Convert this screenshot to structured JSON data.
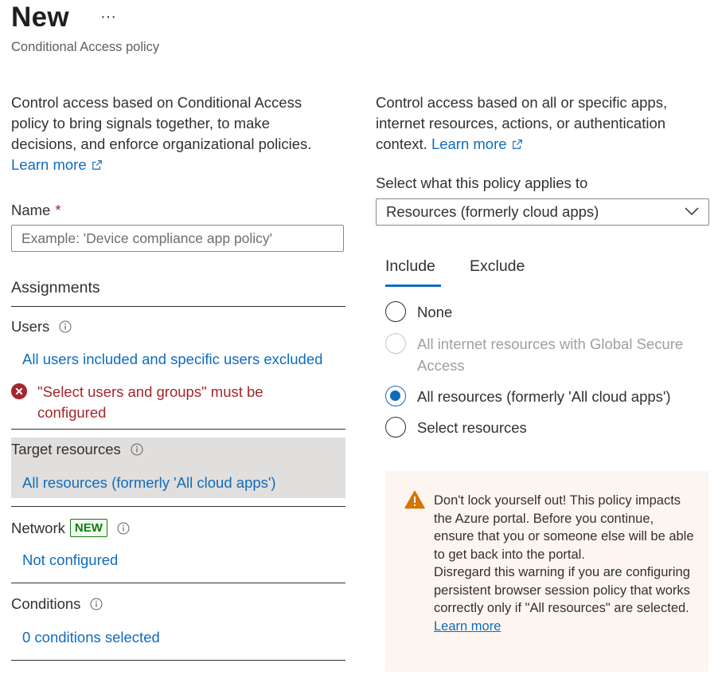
{
  "header": {
    "title": "New",
    "more_label": "···",
    "subtitle": "Conditional Access policy"
  },
  "left": {
    "description": "Control access based on Conditional Access policy to bring signals together, to make decisions, and enforce organizational policies.",
    "learn_more": "Learn more",
    "name_label": "Name",
    "name_required": "*",
    "name_placeholder": "Example: 'Device compliance app policy'",
    "name_value": "",
    "assignments_label": "Assignments",
    "users": {
      "label": "Users",
      "link": "All users included and specific users excluded",
      "error": "\"Select users and groups\" must be configured"
    },
    "target_resources": {
      "label": "Target resources",
      "link": "All resources (formerly 'All cloud apps')"
    },
    "network": {
      "label": "Network",
      "badge": "NEW",
      "link": "Not configured"
    },
    "conditions": {
      "label": "Conditions",
      "link": "0 conditions selected"
    }
  },
  "right": {
    "description": "Control access based on all or specific apps, internet resources, actions, or authentication context.",
    "learn_more": "Learn more",
    "applies_label": "Select what this policy applies to",
    "applies_value": "Resources (formerly cloud apps)",
    "tabs": [
      {
        "label": "Include",
        "active": true
      },
      {
        "label": "Exclude",
        "active": false
      }
    ],
    "options": [
      {
        "label": "None",
        "checked": false,
        "disabled": false
      },
      {
        "label": "All internet resources with Global Secure Access",
        "checked": false,
        "disabled": true
      },
      {
        "label": "All resources (formerly 'All cloud apps')",
        "checked": true,
        "disabled": false
      },
      {
        "label": "Select resources",
        "checked": false,
        "disabled": false
      }
    ],
    "warning": {
      "line1": "Don't lock yourself out! This policy impacts the Azure portal. Before you continue, ensure that you or someone else will be able to get back into the portal.",
      "line2": "Disregard this warning if you are configuring persistent browser session policy that works correctly only if \"All resources\" are selected.",
      "learn_more": "Learn more"
    }
  },
  "colors": {
    "link": "#0f6cbd",
    "error": "#a4262c",
    "new_badge": "#107c10",
    "warning_bg": "#fdf6f0",
    "warning_icon": "#d47500",
    "highlight_bg": "#e1dfdd"
  }
}
